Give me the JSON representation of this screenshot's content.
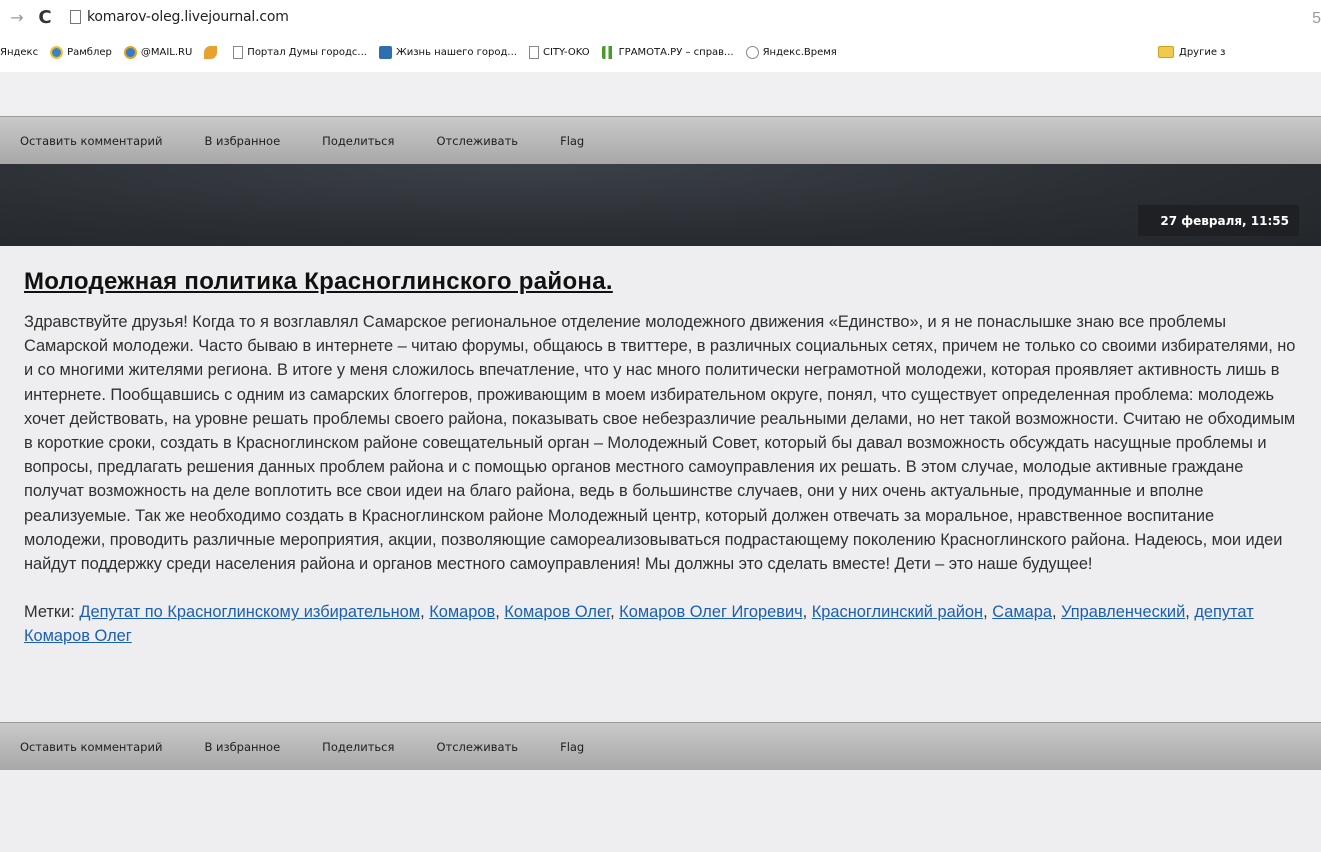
{
  "browser": {
    "url": "komarov-oleg.livejournal.com",
    "forward_icon": "→",
    "reload_icon": "C",
    "right_glyph": "5",
    "bookmarks": [
      {
        "label": "Яндекс",
        "icon": "none",
        "color": ""
      },
      {
        "label": "Рамблер",
        "icon": "rambler-icon",
        "color": "#3b82c4"
      },
      {
        "label": "@MAIL.RU",
        "icon": "mailru-icon",
        "color": "#2a7fd4"
      },
      {
        "label": "",
        "icon": "leaf-icon",
        "color": "#e8a030"
      },
      {
        "label": "Портал Думы городс...",
        "icon": "page-icon",
        "color": ""
      },
      {
        "label": "Жизнь нашего город...",
        "icon": "city-life-icon",
        "color": "#2f6fb0"
      },
      {
        "label": "CITY-OKO",
        "icon": "page-icon",
        "color": ""
      },
      {
        "label": "ГРАМОТА.РУ – справ...",
        "icon": "gramota-icon",
        "color": "#4a9a2a"
      },
      {
        "label": "Яндекс.Время",
        "icon": "clock-icon",
        "color": "#888888"
      }
    ],
    "other_bookmarks": "Другие з"
  },
  "actions_top": [
    "Оставить комментарий",
    "В избранное",
    "Поделиться",
    "Отслеживать",
    "Flag"
  ],
  "actions_bottom": [
    "Оставить комментарий",
    "В избранное",
    "Поделиться",
    "Отслеживать",
    "Flag"
  ],
  "post": {
    "date": "27 февраля, 11:55",
    "title": "Молодежная политика Красноглинского района.",
    "body": "Здравствуйте друзья! Когда то я возглавлял Самарское региональное отделение молодежного движения «Единство», и я не понаслышке знаю все проблемы Самарской молодежи. Часто бываю в интернете – читаю форумы, общаюсь в твиттере, в различных социальных сетях, причем не только со своими избирателями, но и со многими жителями региона. В итоге у меня сложилось впечатление, что у нас много политически неграмотной молодежи, которая проявляет активность лишь в интернете. Пообщавшись с одним из самарских блоггеров, проживающим в моем избирательном округе, понял, что существует определенная проблема: молодежь хочет действовать, на уровне решать проблемы своего района, показывать свое небезразличие реальными делами, но нет такой возможности. Считаю не обходимым в короткие сроки, создать в Красноглинском районе совещательный орган – Молодежный Совет, который бы давал возможность обсуждать насущные проблемы и вопросы, предлагать решения данных проблем района и с помощью органов местного самоуправления их решать. В этом случае, молодые активные граждане получат возможность на деле воплотить все свои идеи на благо района, ведь в большинстве случаев, они у них очень актуальные, продуманные и вполне реализуемые. Так же необходимо создать в Красноглинском районе Молодежный центр, который должен отвечать за моральное, нравственное воспитание молодежи, проводить различные мероприятия, акции, позволяющие самореализовываться подрастающему поколению Красноглинского района. Надеюсь, мои идеи найдут поддержку среди населения района и органов местного самоуправления! Мы должны это сделать вместе! Дети – это наше будущее!",
    "tags_label": "Метки:",
    "tags": [
      "Депутат по Красноглинскому избирательном",
      "Комаров",
      "Комаров Олег",
      "Комаров Олег Игоревич",
      "Красноглинский район",
      "Самара",
      "Управленческий",
      "депутат Комаров Олег"
    ]
  }
}
